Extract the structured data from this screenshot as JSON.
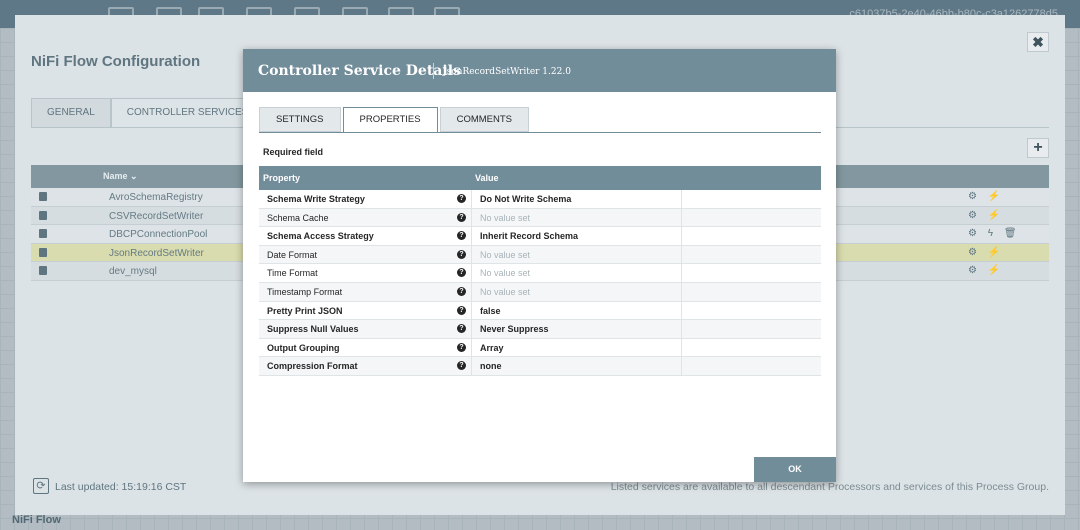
{
  "app": {
    "footer_label": "NiFi Flow",
    "uuid": "c61037b5-2e40-46bb-b80c-c3a1262778d5"
  },
  "flow_config": {
    "title": "NiFi Flow Configuration",
    "close_glyph": "✖",
    "add_glyph": "+",
    "tabs": [
      {
        "label": "GENERAL"
      },
      {
        "label": "CONTROLLER SERVICES"
      }
    ],
    "table": {
      "name_header": "Name ⌄",
      "rows": [
        {
          "name": "AvroSchemaRegistry",
          "actions": "⚙ ⚡"
        },
        {
          "name": "CSVRecordSetWriter",
          "actions": "⚙ ⚡"
        },
        {
          "name": "DBCPConnectionPool",
          "actions": "⚙ ϟ 🗑"
        },
        {
          "name": "JsonRecordSetWriter",
          "actions": "⚙ ⚡"
        },
        {
          "name": "dev_mysql",
          "actions": "⚙ ⚡"
        }
      ]
    },
    "refresh_glyph": "⟳",
    "last_updated": "Last updated: 15:19:16 CST",
    "note": "Listed services are available to all descendant Processors and services of this Process Group."
  },
  "details": {
    "title": "Controller Service Details",
    "subtitle": "JsonRecordSetWriter 1.22.0",
    "tabs": [
      {
        "label": "SETTINGS"
      },
      {
        "label": "PROPERTIES"
      },
      {
        "label": "COMMENTS"
      }
    ],
    "required_label": "Required field",
    "columns": {
      "property": "Property",
      "value": "Value"
    },
    "help_glyph": "?",
    "properties": [
      {
        "name": "Schema Write Strategy",
        "value": "Do Not Write Schema"
      },
      {
        "name": "Schema Cache",
        "value": "No value set"
      },
      {
        "name": "Schema Access Strategy",
        "value": "Inherit Record Schema"
      },
      {
        "name": "Date Format",
        "value": "No value set"
      },
      {
        "name": "Time Format",
        "value": "No value set"
      },
      {
        "name": "Timestamp Format",
        "value": "No value set"
      },
      {
        "name": "Pretty Print JSON",
        "value": "false"
      },
      {
        "name": "Suppress Null Values",
        "value": "Never Suppress"
      },
      {
        "name": "Output Grouping",
        "value": "Array"
      },
      {
        "name": "Compression Format",
        "value": "none"
      }
    ],
    "ok_label": "OK"
  },
  "colors": {
    "header": "#728d9a",
    "selected_row": "#d9dcae"
  }
}
